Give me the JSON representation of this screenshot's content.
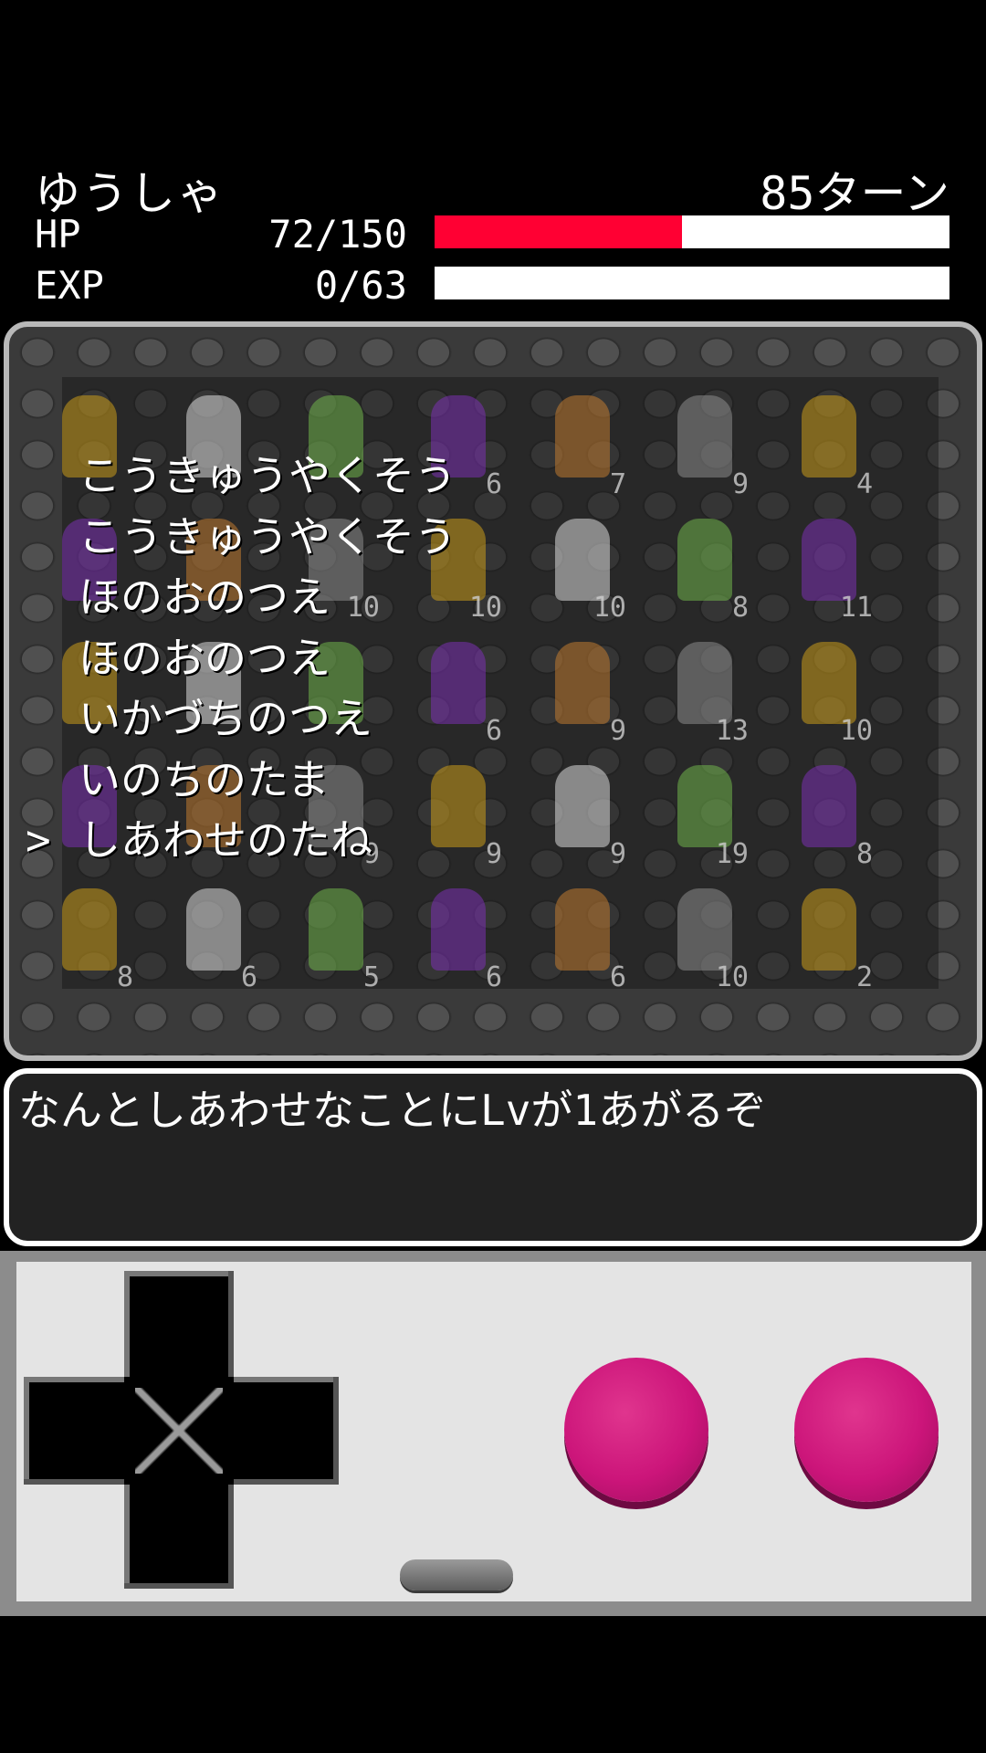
{
  "hero": {
    "name": "ゆうしゃ",
    "turns": "85ターン"
  },
  "hp": {
    "label": "HP",
    "value": "72/150",
    "current": 72,
    "max": 150
  },
  "exp": {
    "label": "EXP",
    "value": "0/63",
    "current": 0,
    "max": 63
  },
  "menu": {
    "cursor": ">",
    "selected_index": 6,
    "items": [
      "こうきゅうやくそう",
      "こうきゅうやくそう",
      "ほのおのつえ",
      "ほのおのつえ",
      "いかづちのつえ",
      "いのちのたま",
      "しあわせのたね"
    ]
  },
  "message": "なんとしあわせなことにLvが1あがるぞ",
  "monster_levels": [
    [
      "",
      "",
      "",
      "6",
      "7",
      "9",
      "4"
    ],
    [
      "",
      "",
      "10",
      "10",
      "10",
      "8",
      "11"
    ],
    [
      "",
      "",
      "",
      "6",
      "9",
      "13",
      "10"
    ],
    [
      "",
      "",
      "9",
      "9",
      "9",
      "19",
      "8"
    ],
    [
      "8",
      "6",
      "5",
      "6",
      "6",
      "10",
      "2"
    ]
  ],
  "colors": {
    "hp_bar": "#ff0033",
    "button": "#cc157a"
  },
  "controls": {
    "dpad": "dpad-icon",
    "button_a": "a-button",
    "button_b": "b-button",
    "select": "select-button"
  }
}
